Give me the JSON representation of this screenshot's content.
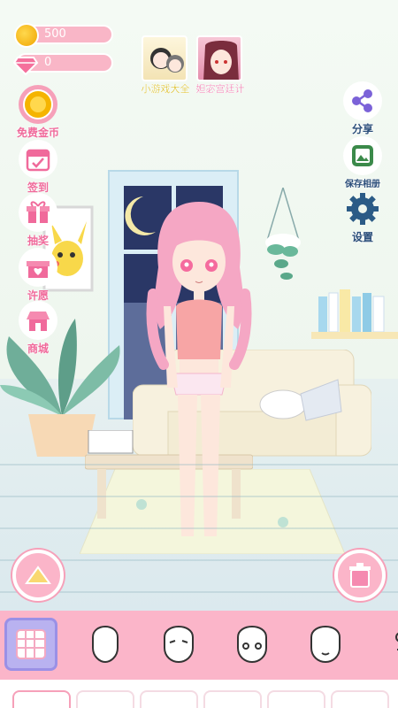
{
  "hud": {
    "coins": "500",
    "gems": "0"
  },
  "promos": [
    {
      "label": "小游戏大全"
    },
    {
      "label": "妲宓宫廷计"
    }
  ],
  "left_buttons": [
    {
      "label": "免费金币",
      "icon": "coin-icon"
    },
    {
      "label": "签到",
      "icon": "calendar-icon"
    },
    {
      "label": "抽奖",
      "icon": "gift-icon"
    },
    {
      "label": "许愿",
      "icon": "wish-gift-icon"
    },
    {
      "label": "商城",
      "icon": "shop-icon"
    }
  ],
  "right_buttons": [
    {
      "label": "分享",
      "icon": "share-icon"
    },
    {
      "label": "保存相册",
      "icon": "save-photo-icon"
    },
    {
      "label": "设置",
      "icon": "gear-icon"
    }
  ],
  "tabs": [
    "background-icon",
    "face-shape-icon",
    "eyebrows-icon",
    "eyes-icon",
    "mouth-icon",
    "accessory-icon"
  ],
  "colors": {
    "pink": "#fbb5c9",
    "accent": "#f06a9b",
    "active_tab": "#b9b2f0"
  }
}
